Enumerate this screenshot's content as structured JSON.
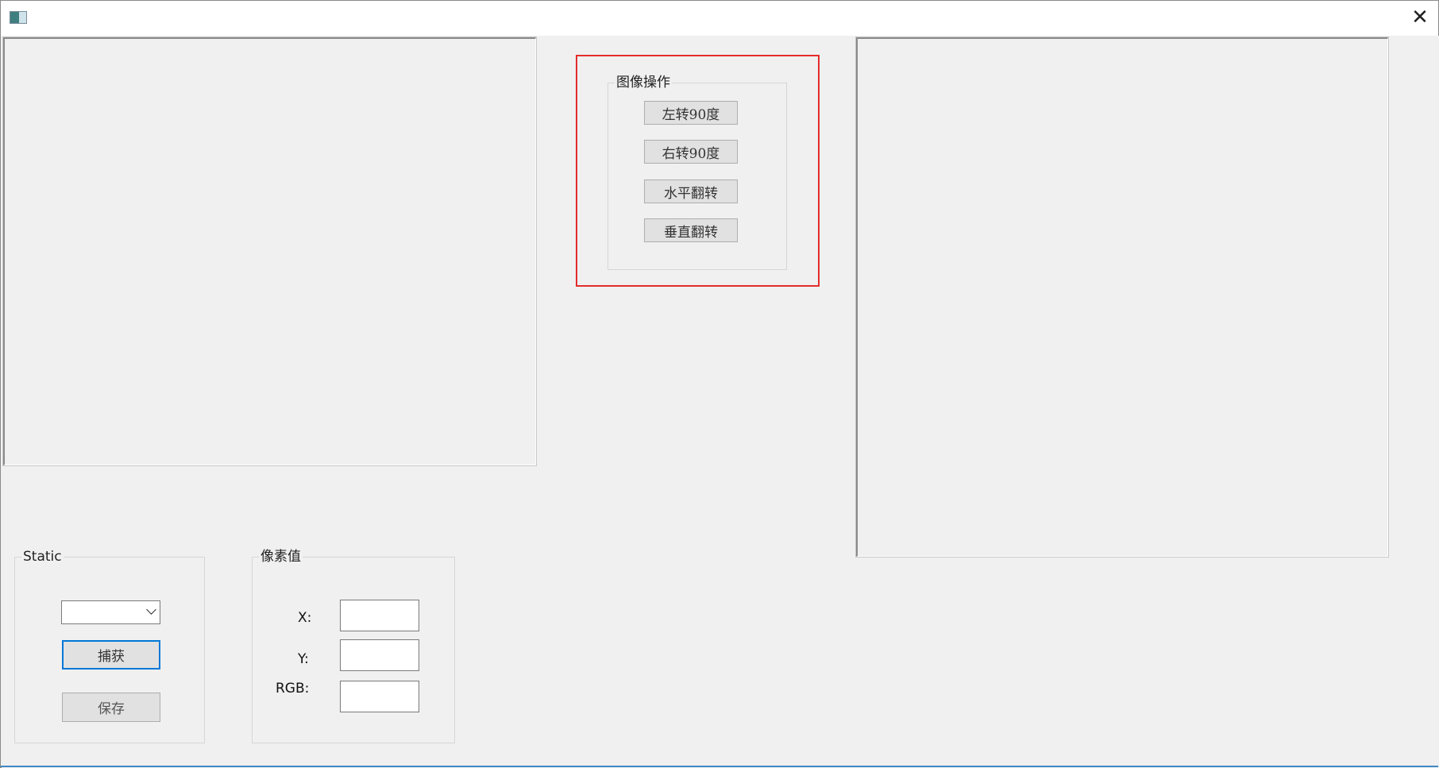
{
  "window": {
    "title": "",
    "close_glyph": "✕",
    "icons": [
      "app-icon",
      "close-icon"
    ]
  },
  "image_ops": {
    "group_label": "图像操作",
    "rotate_left_label": "左转90度",
    "rotate_right_label": "右转90度",
    "flip_horizontal_label": "水平翻转",
    "flip_vertical_label": "垂直翻转"
  },
  "capture": {
    "group_label": "Static",
    "combo_value": "",
    "capture_label": "捕获",
    "save_label": "保存"
  },
  "pixel": {
    "group_label": "像素值",
    "x_label": "X:",
    "y_label": "Y:",
    "rgb_label": "RGB:",
    "x_value": "",
    "y_value": "",
    "rgb_value": ""
  },
  "colors": {
    "highlight": "#e32d2d",
    "focus": "#0078d7",
    "background": "#f0f0f0"
  }
}
